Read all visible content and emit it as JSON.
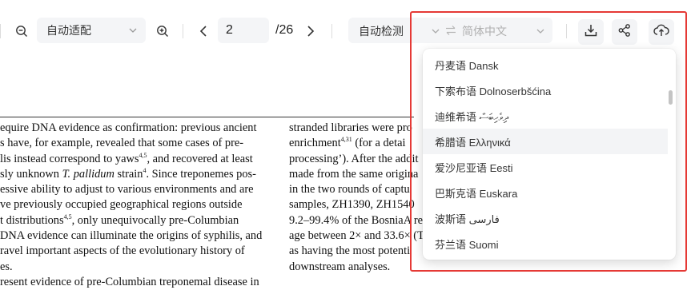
{
  "toolbar": {
    "zoom_select": "自动适配",
    "page_current": "2",
    "page_total": "/26",
    "detect_label": "自动检测",
    "target_language": "简体中文"
  },
  "document": {
    "col1": [
      "equire DNA evidence as confirmation: previous ancient",
      "s have, for example, revealed that some cases of pre-",
      "lis instead correspond to yaws",
      ", and recovered at least",
      "sly unknown ",
      "T. pallidum",
      " strain",
      ". Since treponemes pos-",
      "essive ability to adjust to various environments and are",
      "ve previously occupied geographical regions outside",
      "t distributions",
      ", only unequivocally pre-Columbian",
      "DNA evidence can illuminate the origins of syphilis, and",
      "ravel important aspects of the evolutionary history of",
      "es.",
      "resent evidence of pre-Columbian treponemal disease in"
    ],
    "col1_sups": [
      "4,5",
      "4",
      "4,5"
    ],
    "col2": [
      "stranded libraries were pro",
      "enrichment",
      " (for a detai",
      "processing’). After the addit",
      "made from the same origina",
      "in the two rounds of captu",
      "samples, ZH1390, ZH1540",
      "9.2–99.4% of the BosniaA ref",
      "age between 2× and 33.6× (T",
      "as having the most potenti",
      "downstream analyses."
    ],
    "col2_sups": [
      "4,31"
    ]
  },
  "languages": [
    "丹麦语 Dansk",
    "下索布语 Dolnoserbšćina",
    "迪维希语 ދިވެހިބަސް",
    "希腊语 Ελληνικά",
    "爱沙尼亚语 Eesti",
    "巴斯克语 Euskara",
    "波斯语 فارسی",
    "芬兰语 Suomi"
  ],
  "colors": {
    "highlight": "#e53935",
    "active_option": "#f3f4f6"
  }
}
